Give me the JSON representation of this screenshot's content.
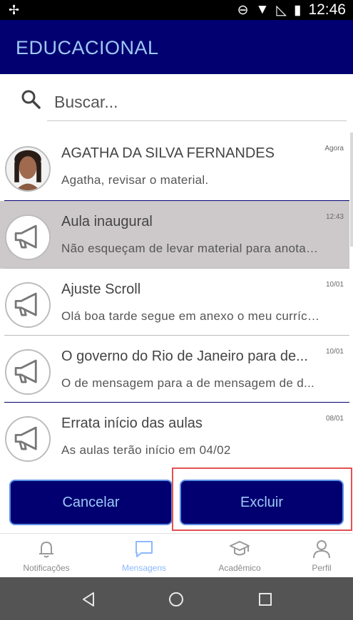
{
  "status_bar": {
    "time": "12:46"
  },
  "app_bar": {
    "title": "EDUCACIONAL"
  },
  "search": {
    "placeholder": "Buscar..."
  },
  "messages": [
    {
      "name": "AGATHA DA SILVA FERNANDES",
      "preview": "Agatha, revisar o material.",
      "time": "Agora",
      "avatar": "person-photo",
      "selected": false
    },
    {
      "name": "Aula inaugural",
      "preview": "Não esqueçam de levar material para anotações",
      "time": "12:43",
      "avatar": "megaphone-icon",
      "selected": true
    },
    {
      "name": "Ajuste Scroll",
      "preview": "Olá boa tarde segue em anexo o meu currículo",
      "time": "10/01",
      "avatar": "megaphone-icon",
      "selected": false
    },
    {
      "name": "O governo do Rio de Janeiro para de...",
      "preview": "O de mensagem para a de mensagem de d...",
      "time": "10/01",
      "avatar": "megaphone-icon",
      "selected": false
    },
    {
      "name": "Errata início das aulas",
      "preview": "As aulas terão início em 04/02",
      "time": "08/01",
      "avatar": "megaphone-icon",
      "selected": false
    }
  ],
  "actions": {
    "cancel_label": "Cancelar",
    "delete_label": "Excluir"
  },
  "bottom_nav": [
    {
      "label": "Notificações",
      "icon": "bell-icon",
      "active": false
    },
    {
      "label": "Mensagens",
      "icon": "chat-icon",
      "active": true
    },
    {
      "label": "Acadêmico",
      "icon": "graduation-cap-icon",
      "active": false
    },
    {
      "label": "Perfil",
      "icon": "person-icon",
      "active": false
    }
  ],
  "colors": {
    "primary": "#020070",
    "accent": "#9ec8f5",
    "selected_row": "#cdc9cb",
    "highlight": "#e35152",
    "active_nav": "#8cb8ff"
  }
}
